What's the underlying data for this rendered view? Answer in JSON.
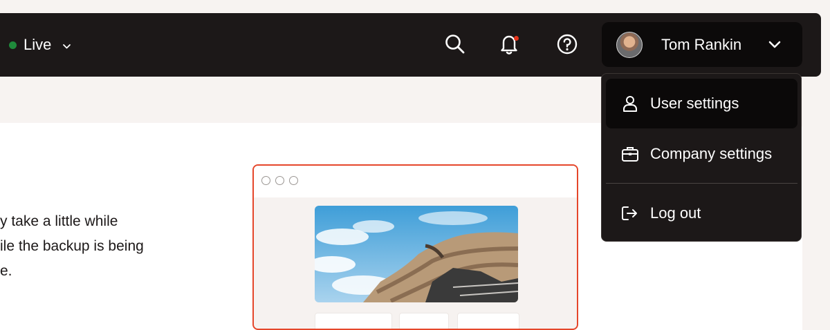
{
  "header": {
    "environment": {
      "label": "Live",
      "status_color": "#1f8a3b"
    },
    "icons": [
      "search-icon",
      "bell-icon",
      "help-icon"
    ],
    "notification_dot_color": "#e5331b",
    "user": {
      "name": "Tom Rankin"
    }
  },
  "user_menu": {
    "items": [
      {
        "label": "User settings",
        "icon": "user-icon",
        "active": true
      },
      {
        "label": "Company settings",
        "icon": "briefcase-icon",
        "active": false
      },
      {
        "label": "Log out",
        "icon": "logout-icon",
        "active": false
      }
    ]
  },
  "content": {
    "info_lines": [
      "y take a little while",
      "ile the backup is being",
      "e."
    ],
    "preview_accent": "#e5462a"
  }
}
